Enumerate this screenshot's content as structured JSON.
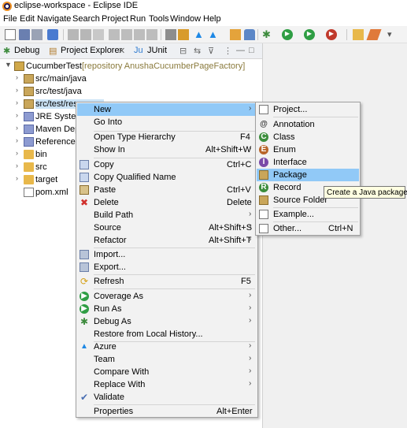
{
  "window": {
    "title": "eclipse-workspace - Eclipse IDE"
  },
  "menubar": {
    "items": [
      "File",
      "Edit",
      "Navigate",
      "Search",
      "Project",
      "Run",
      "Tools",
      "Window",
      "Help"
    ]
  },
  "toolbar": {
    "icons": [
      "new-icon",
      "save-icon",
      "print-icon",
      "debug-run-icon",
      "run-icon",
      "stop-icon",
      "new-java-project-icon",
      "new-package-icon",
      "new-class-icon",
      "search-icon",
      "azure-icon",
      "external-tools-icon",
      "lock-icon",
      "debug-icon",
      "run-icon",
      "coverage-icon",
      "open-type-icon",
      "pen-icon"
    ]
  },
  "tabs": {
    "debug": "Debug",
    "project_explorer": "Project Explorer",
    "junit": "JUnit"
  },
  "tree": {
    "project": "CucumberTest",
    "project_repo": "[repository AnushaCucumberPageFactory]",
    "items": [
      "src/main/java",
      "src/test/java",
      "src/test/resources",
      "JRE System",
      "Maven Dep",
      "Referenced",
      "bin",
      "src",
      "target",
      "pom.xml"
    ]
  },
  "context_menu": {
    "new": "New",
    "go_into": "Go Into",
    "open_type_hierarchy": "Open Type Hierarchy",
    "open_type_hierarchy_sc": "F4",
    "show_in": "Show In",
    "show_in_sc": "Alt+Shift+W",
    "copy": "Copy",
    "copy_sc": "Ctrl+C",
    "copy_qualified_name": "Copy Qualified Name",
    "paste": "Paste",
    "paste_sc": "Ctrl+V",
    "delete": "Delete",
    "delete_sc": "Delete",
    "build_path": "Build Path",
    "source": "Source",
    "source_sc": "Alt+Shift+S",
    "refactor": "Refactor",
    "refactor_sc": "Alt+Shift+T",
    "import": "Import...",
    "export": "Export...",
    "refresh": "Refresh",
    "refresh_sc": "F5",
    "coverage_as": "Coverage As",
    "run_as": "Run As",
    "debug_as": "Debug As",
    "restore_history": "Restore from Local History...",
    "azure": "Azure",
    "team": "Team",
    "compare_with": "Compare With",
    "replace_with": "Replace With",
    "validate": "Validate",
    "properties": "Properties",
    "properties_sc": "Alt+Enter"
  },
  "submenu": {
    "project": "Project...",
    "annotation": "Annotation",
    "class": "Class",
    "enum": "Enum",
    "interface": "Interface",
    "package": "Package",
    "record": "Record",
    "source_folder": "Source Folder",
    "example": "Example...",
    "other": "Other...",
    "other_sc": "Ctrl+N"
  },
  "tooltip": "Create a Java package",
  "colors": {
    "highlight": "#91c9f7",
    "menu_bg": "#f2f2f2",
    "repo_text": "#8a7a3c"
  }
}
